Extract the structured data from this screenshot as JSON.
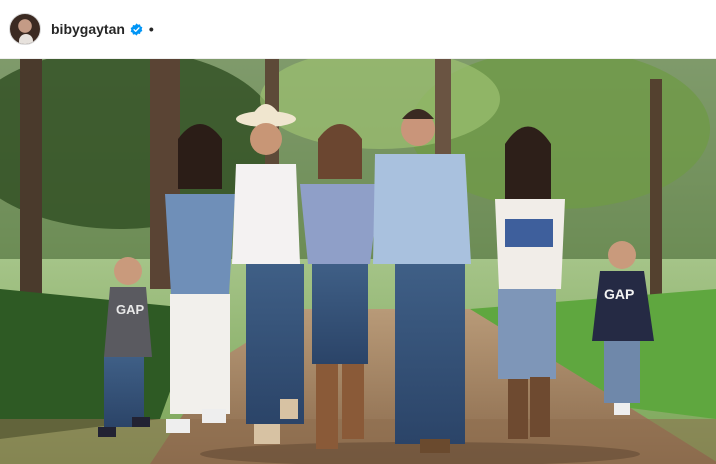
{
  "post_header": {
    "username": "bibygaytan",
    "separator": "•",
    "verified": true
  },
  "icons": {
    "verified_badge": "verified-badge-icon",
    "avatar": "profile-avatar"
  },
  "colors": {
    "verified_blue": "#0095f6",
    "text": "#262626"
  }
}
